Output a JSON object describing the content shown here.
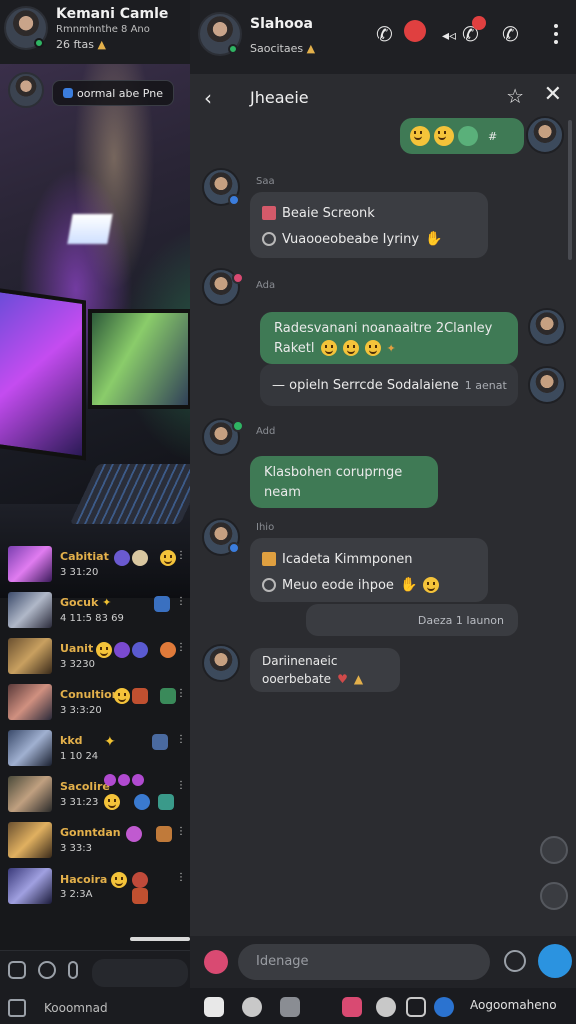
{
  "left_panel": {
    "profile": {
      "name": "Kemani Camle",
      "status_line": "Rmnmhnthe 8 Ano",
      "sub_line": "26 ftas"
    },
    "status_pill": "oormal abe Pne",
    "games": [
      {
        "title": "Cabitiat",
        "sub": "3 31:20"
      },
      {
        "title": "Gocuk",
        "sub": "4 11:5 83 69"
      },
      {
        "title": "Uanit",
        "sub": "3 3230"
      },
      {
        "title": "Conultion",
        "sub": "3 3:3:20"
      },
      {
        "title": "kkd",
        "sub": "1 10 24"
      },
      {
        "title": "Sacolire",
        "sub": "3 31:23"
      },
      {
        "title": "Gonntdan",
        "sub": "3 33:3"
      },
      {
        "title": "Hacoira",
        "sub": "3 2:3A"
      }
    ],
    "footer_text": "Kooomnad"
  },
  "right_panel": {
    "header": {
      "name": "Slahooa",
      "sub": "Saocitaes"
    },
    "conversation_title": "Jheaeie",
    "messages": [
      {
        "id": "m1",
        "stamp": "Saa",
        "line1": "Beaie Screonk",
        "line2": "Vuaooeobeabe Iyriny"
      },
      {
        "id": "m2",
        "stamp": "Ada",
        "line1": "Radesvanani noanaaitre 2Clanley",
        "line2": "Raketl",
        "meta": "— opieln Serrcde Sodalaiene",
        "time": "1 aenat"
      },
      {
        "id": "m3",
        "stamp": "Add",
        "line1": "Klasbohen coruprnge",
        "line2": "neam"
      },
      {
        "id": "m4",
        "stamp": "Ihio",
        "line1": "Icadeta Kimmponen",
        "line2": "Meuo eode ihpoe",
        "time_pill": "Daeza 1 Iaunon"
      },
      {
        "id": "m5",
        "line1": "Dariinenaeic",
        "line2": "ooerbebate"
      }
    ],
    "composer_placeholder": "Idenage",
    "toolbar_text": "Aogoomaheno"
  },
  "colors": {
    "accent_green": "#3f7a55",
    "bubble_dark": "#3b3d42",
    "send_blue": "#2b93e0",
    "game_title": "#e3b04b"
  }
}
